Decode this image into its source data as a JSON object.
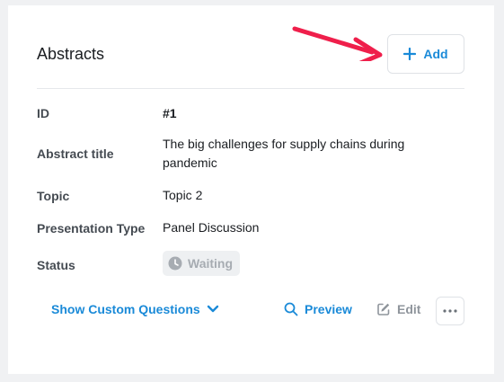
{
  "card": {
    "title": "Abstracts",
    "add_label": "Add"
  },
  "fields": {
    "id": {
      "label": "ID",
      "value": "#1"
    },
    "abstract_title": {
      "label": "Abstract title",
      "value": "The big challenges for supply chains during pandemic"
    },
    "topic": {
      "label": "Topic",
      "value": "Topic 2"
    },
    "presentation_type": {
      "label": "Presentation Type",
      "value": "Panel Discussion"
    },
    "status": {
      "label": "Status",
      "value": "Waiting"
    }
  },
  "actions": {
    "show_custom_questions": "Show Custom Questions",
    "preview": "Preview",
    "edit": "Edit"
  },
  "icons": {
    "add": "plus-icon",
    "annotation": "red-arrow-icon",
    "status": "clock-icon",
    "expand": "chevron-down-icon",
    "preview": "search-icon",
    "edit": "pencil-icon",
    "more": "ellipsis-icon"
  },
  "colors": {
    "accent": "#1a8ad8",
    "arrow": "#ef1f4b",
    "muted": "#8f959c"
  }
}
